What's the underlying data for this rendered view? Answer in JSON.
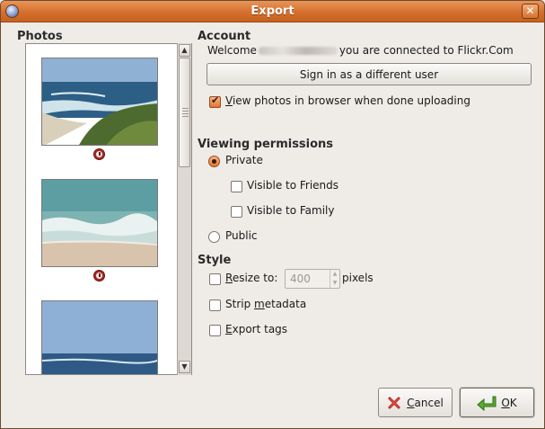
{
  "window": {
    "title": "Export",
    "close_glyph": "✕"
  },
  "photos": {
    "label": "Photos"
  },
  "account": {
    "label": "Account",
    "welcome_prefix": "Welcome",
    "welcome_suffix": "you are connected to Flickr.Com",
    "sign_in_button": "Sign in as a different user",
    "view_in_browser_prefix": "",
    "view_in_browser_mnemonic": "V",
    "view_in_browser_rest": "iew photos in browser when done uploading",
    "view_in_browser_checked": true
  },
  "permissions": {
    "label": "Viewing permissions",
    "private_label": "Private",
    "friends_label": "Visible to Friends",
    "family_label": "Visible to Family",
    "public_label": "Public",
    "selected": "Private"
  },
  "style": {
    "label": "Style",
    "resize_mnemonic": "R",
    "resize_rest": "esize to:",
    "resize_value": "400",
    "resize_unit": "pixels",
    "strip_prefix": "Strip ",
    "strip_mnemonic": "m",
    "strip_rest": "etadata",
    "export_mnemonic": "E",
    "export_rest": "xport tags"
  },
  "buttons": {
    "cancel_mnemonic": "C",
    "cancel_rest": "ancel",
    "ok_mnemonic": "O",
    "ok_rest": "K"
  },
  "icons": {
    "window_menu": "window-menu-icon",
    "close": "close-icon",
    "photo_status": "clock-icon",
    "cancel": "cancel-x-icon",
    "ok": "ok-arrow-icon"
  },
  "colors": {
    "titlebar": "#d46f2e",
    "check_accent": "#e2752f"
  }
}
